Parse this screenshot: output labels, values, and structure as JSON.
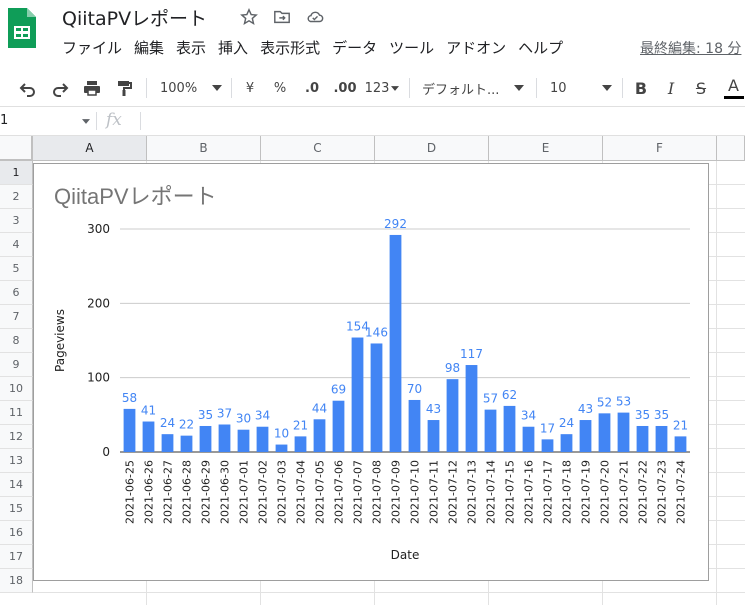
{
  "app": {
    "icon": "google-sheets-icon"
  },
  "document": {
    "title": "QiitaPVレポート"
  },
  "menu": [
    "ファイル",
    "編集",
    "表示",
    "挿入",
    "表示形式",
    "データ",
    "ツール",
    "アドオン",
    "ヘルプ"
  ],
  "last_edit": "最終編集: 18 分",
  "toolbar": {
    "zoom": "100%",
    "currency": "¥",
    "percent": "%",
    "decrease_decimal": ".0",
    "increase_decimal": ".00",
    "more_formats": "123",
    "font": "デフォルト...",
    "font_size": "10",
    "bold": "B",
    "italic": "I",
    "strikethrough": "S",
    "text_color": "A"
  },
  "formula_bar": {
    "cell_ref": "1",
    "fx": "fx",
    "value": ""
  },
  "columns": [
    "A",
    "B",
    "C",
    "D",
    "E",
    "F"
  ],
  "rows": [
    "1",
    "2",
    "3",
    "4",
    "5",
    "6",
    "7",
    "8",
    "9",
    "10",
    "11",
    "12",
    "13",
    "14",
    "15",
    "16",
    "17",
    "18"
  ],
  "colors": {
    "bar": "#4285f4",
    "label": "#4285f4",
    "sheets_green": "#0f9d58"
  },
  "chart_data": {
    "type": "bar",
    "title": "QiitaPVレポート",
    "xlabel": "Date",
    "ylabel": "Pageviews",
    "ylim": [
      0,
      300
    ],
    "yticks": [
      0,
      100,
      200,
      300
    ],
    "grid": true,
    "categories": [
      "2021-06-25",
      "2021-06-26",
      "2021-06-27",
      "2021-06-28",
      "2021-06-29",
      "2021-06-30",
      "2021-07-01",
      "2021-07-02",
      "2021-07-03",
      "2021-07-04",
      "2021-07-05",
      "2021-07-06",
      "2021-07-07",
      "2021-07-08",
      "2021-07-09",
      "2021-07-10",
      "2021-07-11",
      "2021-07-12",
      "2021-07-13",
      "2021-07-14",
      "2021-07-15",
      "2021-07-16",
      "2021-07-17",
      "2021-07-18",
      "2021-07-19",
      "2021-07-20",
      "2021-07-21",
      "2021-07-22",
      "2021-07-23",
      "2021-07-24"
    ],
    "values": [
      58,
      41,
      24,
      22,
      35,
      37,
      30,
      34,
      10,
      21,
      44,
      69,
      154,
      146,
      292,
      70,
      43,
      98,
      117,
      57,
      62,
      34,
      17,
      24,
      43,
      52,
      53,
      35,
      35,
      21
    ]
  }
}
